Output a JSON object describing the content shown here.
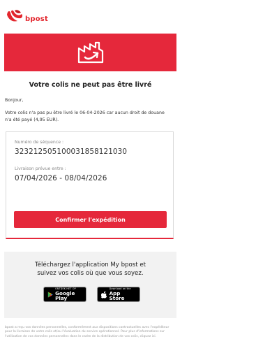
{
  "brand": {
    "name": "bpost",
    "accent": "#e5283b"
  },
  "banner": {
    "icon": "factory-truck-icon"
  },
  "title": "Votre colis ne peut pas être livré",
  "greeting": "Bonjour,",
  "message": "Votre colis n'a pas pu être livré le 06-04-2026 car aucun droit de douane n'a été payé (4,95 EUR).",
  "tracking": {
    "label": "Numéro de séquence :",
    "value": "323212505100031858121030",
    "delivery_label": "Livraison prévue entre :",
    "delivery_value": "07/04/2026 - 08/04/2026",
    "button": "Confirmer l'expédition"
  },
  "app": {
    "line1": "Téléchargez l'application My bpost et",
    "line2": "suivez vos colis où que vous soyez.",
    "google_small": "ONTDEK HET OP",
    "google_big": "Google Play",
    "apple_small": "Download on the",
    "apple_big": "App Store"
  },
  "footer": "bpost a reçu vos données personnelles, conformément aux dispositions contractuelles avec l'expéditeur pour la livraison de votre colis et/ou l'évaluation du service opérationnel. Pour plus d'informations sur l'utilisation de vos données personnelles dans le cadre de la distribution de vos colis, cliquez ici."
}
